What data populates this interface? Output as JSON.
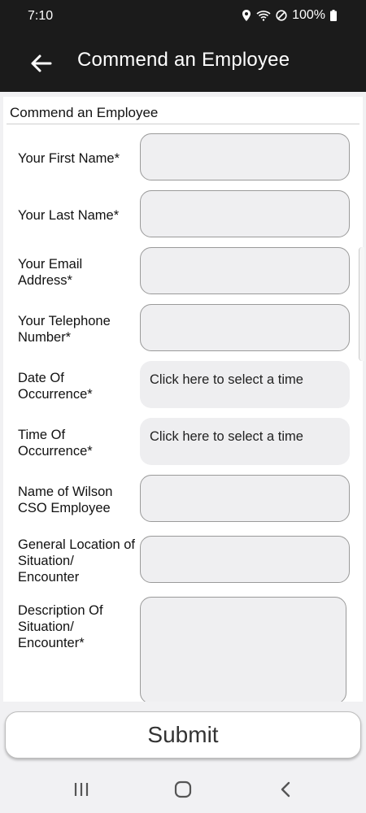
{
  "status_bar": {
    "time": "7:10",
    "battery": "100%"
  },
  "app_bar": {
    "title": "Commend an Employee",
    "back_icon": "arrow-back-icon"
  },
  "form": {
    "header": "Commend an Employee",
    "fields": [
      {
        "label": "Your First Name*",
        "type": "text",
        "value": ""
      },
      {
        "label": "Your Last Name*",
        "type": "text",
        "value": ""
      },
      {
        "label": "Your Email Address*",
        "type": "text",
        "value": ""
      },
      {
        "label": "Your Telephone Number*",
        "type": "text",
        "value": ""
      },
      {
        "label": "Date Of Occurrence*",
        "type": "picker",
        "value": "Click here to select a time"
      },
      {
        "label": "Time Of Occurrence*",
        "type": "picker",
        "value": "Click here to select a time"
      },
      {
        "label": "Name of Wilson CSO Employee",
        "type": "text",
        "value": ""
      },
      {
        "label": "General Location of Situation/ Encounter",
        "type": "text",
        "value": ""
      },
      {
        "label": "Description Of Situation/ Encounter*",
        "type": "textarea",
        "value": ""
      }
    ]
  },
  "submit_label": "Submit",
  "nav": {
    "recents_icon": "recents-icon",
    "home_icon": "home-icon",
    "back_icon": "nav-back-icon"
  },
  "colors": {
    "app_bar": "#1b1b1b",
    "field_bg": "#efeff1",
    "page_bg": "#f1f1f3"
  }
}
